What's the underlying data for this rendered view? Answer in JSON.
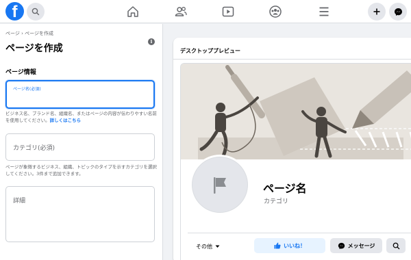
{
  "topbar": {
    "logo_letter": "f",
    "nav_icons": [
      "home-icon",
      "friends-icon",
      "watch-icon",
      "groups-icon",
      "menu-icon"
    ],
    "right_icons": [
      "plus-icon",
      "messenger-icon"
    ]
  },
  "left": {
    "breadcrumb": "ページ › ページを作成",
    "title": "ページを作成",
    "section_title": "ページ情報",
    "name_field": {
      "label": "ページ名(必須)",
      "value": ""
    },
    "name_help": "ビジネス名、ブランド名、組織名、またはページの内容が伝わりやすい名前を使用してください。",
    "name_help_link": "詳しくはこちら",
    "category_field": {
      "placeholder": "カテゴリ(必須)"
    },
    "category_help": "ページが象徴するビジネス、組織、トピックのタイプを示すカテゴリを選択してください。3件まで追加できます。",
    "details_field": {
      "placeholder": "詳細"
    }
  },
  "preview": {
    "title": "デスクトッププレビュー",
    "page_name": "ページ名",
    "category": "カテゴリ",
    "more_label": "その他",
    "like_label": "いいね！",
    "message_label": "メッセージ"
  },
  "colors": {
    "brand": "#1877f2",
    "background": "#f0f2f5",
    "cover": "#e9e5df"
  }
}
